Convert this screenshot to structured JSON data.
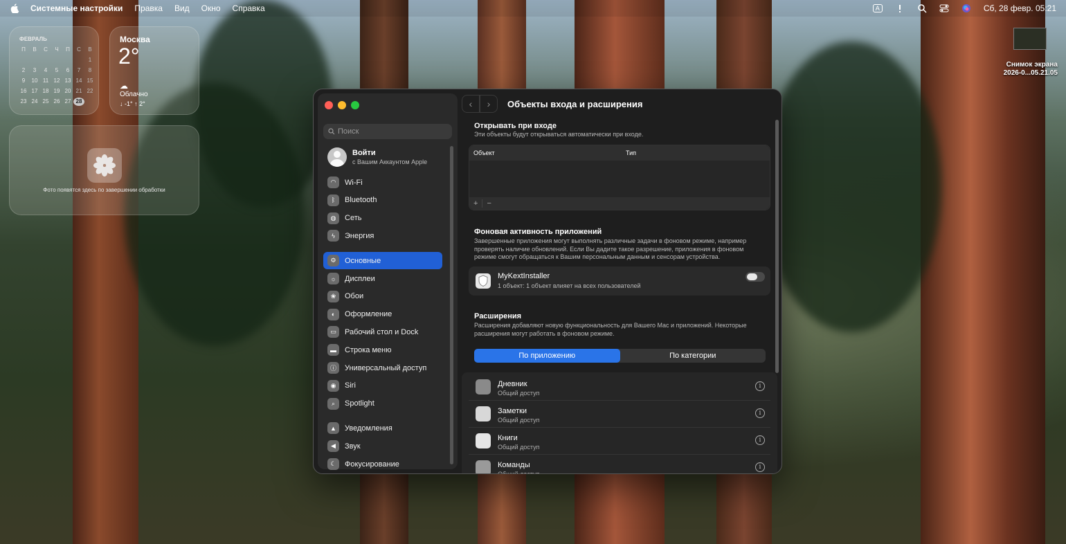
{
  "menubar": {
    "app_name": "Системные настройки",
    "items": [
      "Правка",
      "Вид",
      "Окно",
      "Справка"
    ],
    "datetime": "Сб, 28 февр.  05:21",
    "input_badge": "A"
  },
  "calendar": {
    "month": "ФЕВРАЛЬ",
    "weekdays": [
      "П",
      "В",
      "С",
      "Ч",
      "П",
      "С",
      "В"
    ],
    "days": [
      "",
      "",
      "",
      "",
      "",
      "",
      "1",
      "2",
      "3",
      "4",
      "5",
      "6",
      "7",
      "8",
      "9",
      "10",
      "11",
      "12",
      "13",
      "14",
      "15",
      "16",
      "17",
      "18",
      "19",
      "20",
      "21",
      "22",
      "23",
      "24",
      "25",
      "26",
      "27",
      "28",
      ""
    ],
    "today": "28"
  },
  "weather": {
    "city": "Москва",
    "temp": "2°",
    "condition": "Облачно",
    "range": "↓ -1° ↑ 2°"
  },
  "photos": {
    "message": "Фото появятся здесь по завершении обработки"
  },
  "desktop_file": {
    "line1": "Снимок экрана",
    "line2": "2026-0...05.21.05"
  },
  "sidebar": {
    "search_placeholder": "Поиск",
    "account_name": "Войти",
    "account_sub": "с Вашим Аккаунтом Apple",
    "items": [
      {
        "label": "Wi-Fi",
        "icon": "wifi-icon",
        "color": "#6b6b6b"
      },
      {
        "label": "Bluetooth",
        "icon": "bluetooth-icon",
        "color": "#6b6b6b"
      },
      {
        "label": "Сеть",
        "icon": "globe-icon",
        "color": "#6b6b6b"
      },
      {
        "label": "Энергия",
        "icon": "battery-icon",
        "color": "#6b6b6b"
      },
      {
        "label": "Основные",
        "icon": "gear-icon",
        "color": "#6b6b6b"
      },
      {
        "label": "Дисплеи",
        "icon": "sun-icon",
        "color": "#6b6b6b"
      },
      {
        "label": "Обои",
        "icon": "flower-icon",
        "color": "#6b6b6b"
      },
      {
        "label": "Оформление",
        "icon": "appearance-icon",
        "color": "#6b6b6b"
      },
      {
        "label": "Рабочий стол и Dock",
        "icon": "dock-icon",
        "color": "#6b6b6b"
      },
      {
        "label": "Строка меню",
        "icon": "menubar-icon",
        "color": "#6b6b6b"
      },
      {
        "label": "Универсальный доступ",
        "icon": "accessibility-icon",
        "color": "#6b6b6b"
      },
      {
        "label": "Siri",
        "icon": "siri-icon",
        "color": "#6b6b6b"
      },
      {
        "label": "Spotlight",
        "icon": "magnifier-icon",
        "color": "#6b6b6b"
      },
      {
        "label": "Уведомления",
        "icon": "bell-icon",
        "color": "#6b6b6b"
      },
      {
        "label": "Звук",
        "icon": "speaker-icon",
        "color": "#6b6b6b"
      },
      {
        "label": "Фокусирование",
        "icon": "moon-icon",
        "color": "#6b6b6b"
      }
    ],
    "active_index": 4,
    "accent": "#2160d6"
  },
  "content": {
    "title": "Объекты входа и расширения",
    "login": {
      "title": "Открывать при входе",
      "desc": "Эти объекты будут открываться автоматически при входе.",
      "col_object": "Объект",
      "col_type": "Тип",
      "add": "+",
      "remove": "−"
    },
    "background": {
      "title": "Фоновая активность приложений",
      "desc": "Завершенные приложения могут выполнять различные задачи в фоновом режиме, например проверять наличие обновлений. Если Вы дадите такое разрешение, приложения в фоновом режиме смогут обращаться к Вашим персональным данным и сенсорам устройства.",
      "app_name": "MyKextInstaller",
      "app_sub": "1 объект: 1 объект влияет на всех пользователей",
      "toggle_on": false
    },
    "extensions": {
      "title": "Расширения",
      "desc": "Расширения добавляют новую функциональность для Вашего Mac и приложений. Некоторые расширения могут работать в фоновом режиме.",
      "seg_app": "По приложению",
      "seg_category": "По категории",
      "rows": [
        {
          "name": "Дневник",
          "sub": "Общий доступ",
          "icon": "journal-icon",
          "color": "#8a8a8a"
        },
        {
          "name": "Заметки",
          "sub": "Общий доступ",
          "icon": "notes-icon",
          "color": "#d8d8d8"
        },
        {
          "name": "Книги",
          "sub": "Общий доступ",
          "icon": "books-icon",
          "color": "#e6e6e6"
        },
        {
          "name": "Команды",
          "sub": "Общий доступ",
          "icon": "shortcuts-icon",
          "color": "#9a9a9a"
        }
      ]
    }
  }
}
